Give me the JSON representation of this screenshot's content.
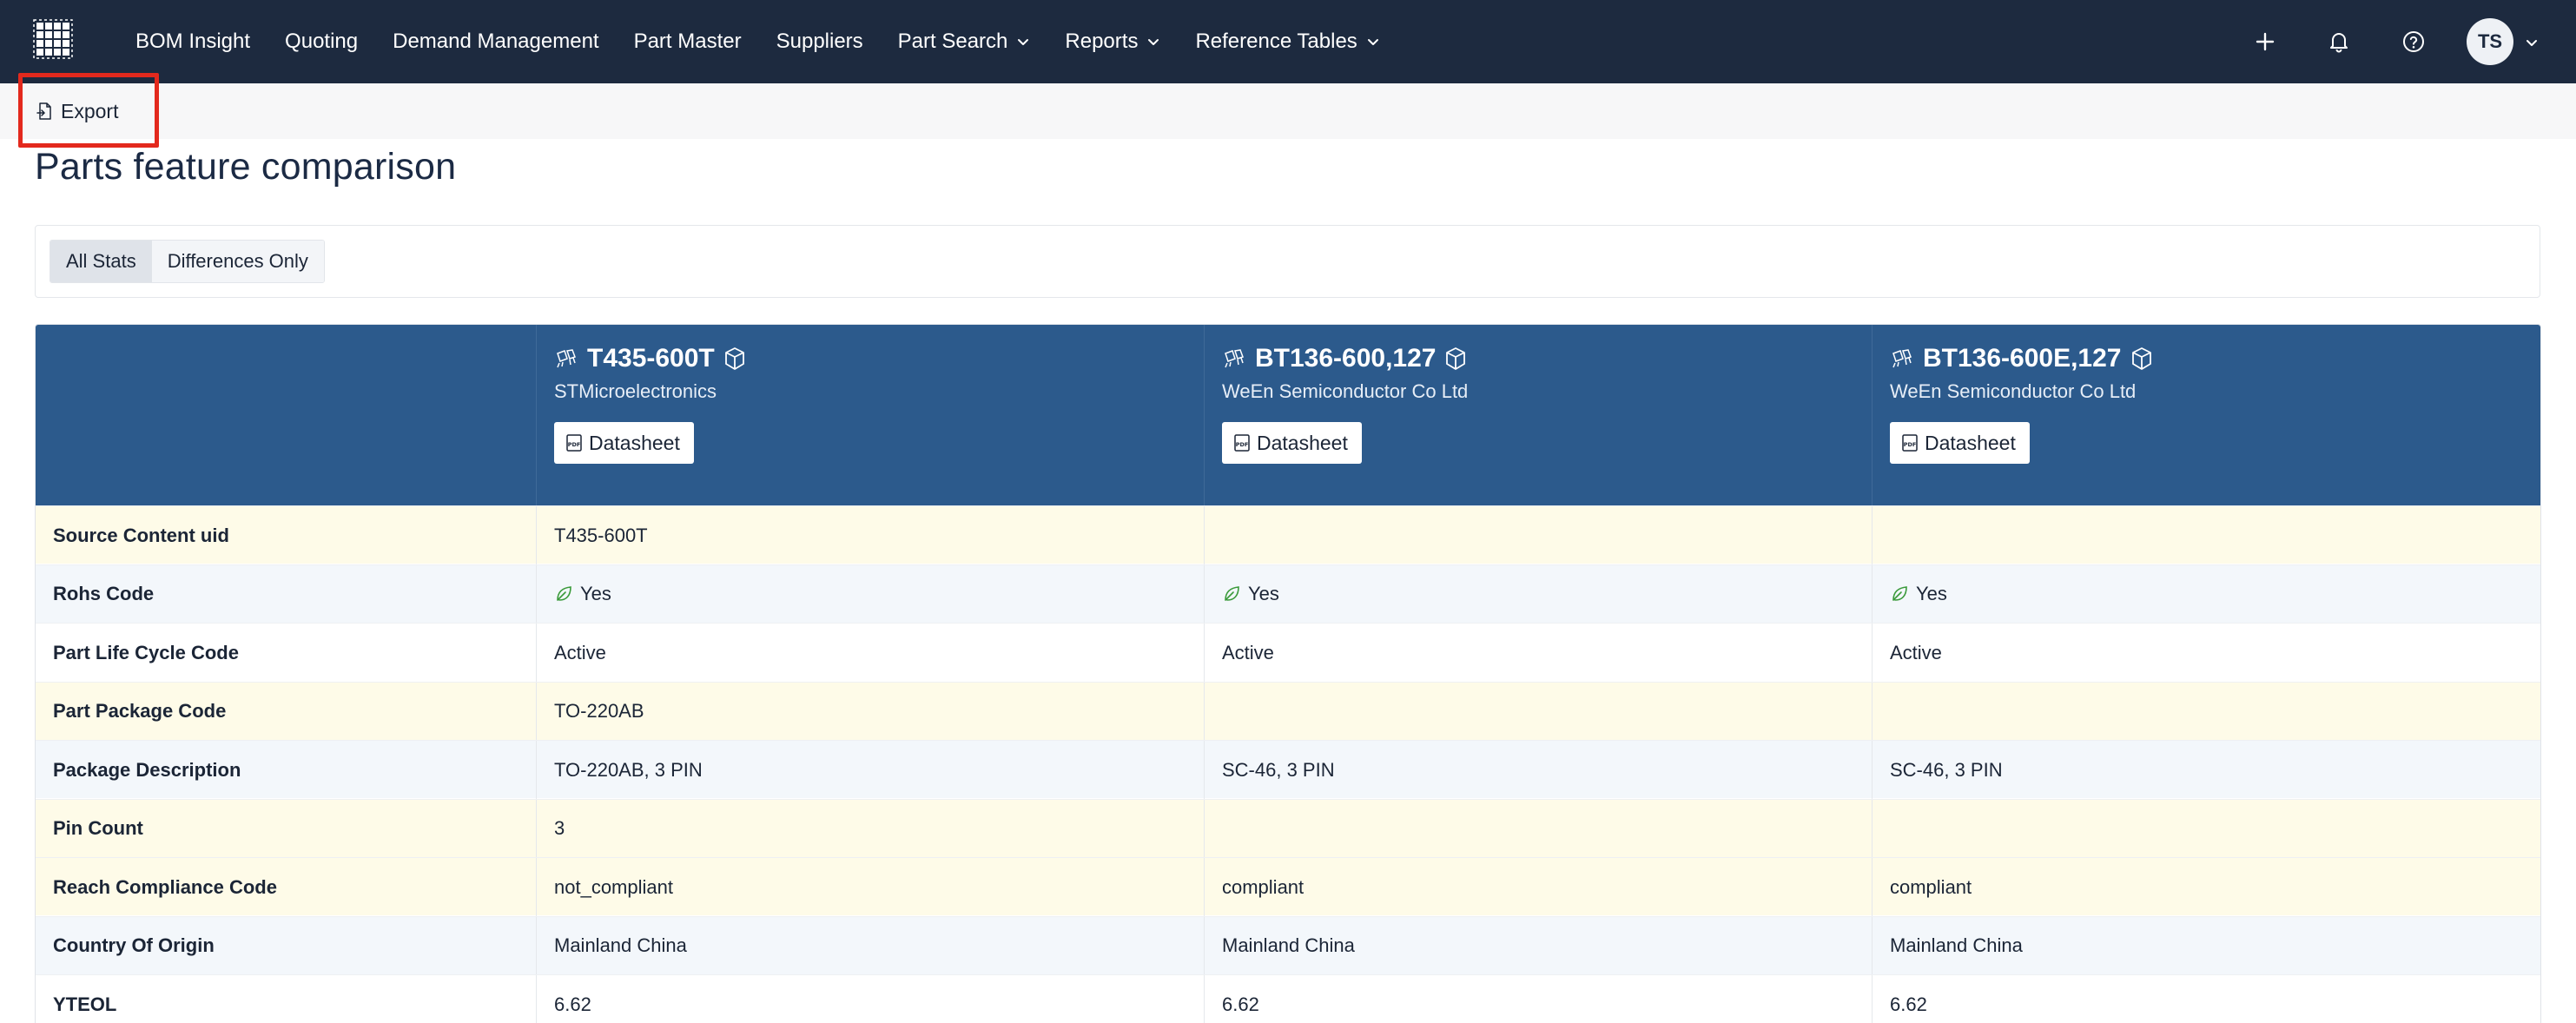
{
  "nav": {
    "items": [
      {
        "label": "BOM Insight",
        "dropdown": false
      },
      {
        "label": "Quoting",
        "dropdown": false
      },
      {
        "label": "Demand Management",
        "dropdown": false
      },
      {
        "label": "Part Master",
        "dropdown": false
      },
      {
        "label": "Suppliers",
        "dropdown": false
      },
      {
        "label": "Part Search",
        "dropdown": true
      },
      {
        "label": "Reports",
        "dropdown": true
      },
      {
        "label": "Reference Tables",
        "dropdown": true
      }
    ],
    "avatar_initials": "TS"
  },
  "toolbar": {
    "export_label": "Export"
  },
  "page_title": "Parts feature comparison",
  "filter": {
    "all_label": "All Stats",
    "diff_label": "Differences Only",
    "selected": "All Stats"
  },
  "parts": [
    {
      "name": "T435-600T",
      "manufacturer": "STMicroelectronics",
      "datasheet_label": "Datasheet"
    },
    {
      "name": "BT136-600,127",
      "manufacturer": "WeEn Semiconductor Co Ltd",
      "datasheet_label": "Datasheet"
    },
    {
      "name": "BT136-600E,127",
      "manufacturer": "WeEn Semiconductor Co Ltd",
      "datasheet_label": "Datasheet"
    }
  ],
  "rows": [
    {
      "label": "Source Content uid",
      "values": [
        "T435-600T",
        "",
        ""
      ]
    },
    {
      "label": "Rohs Code",
      "values": [
        "Yes",
        "Yes",
        "Yes"
      ]
    },
    {
      "label": "Part Life Cycle Code",
      "values": [
        "Active",
        "Active",
        "Active"
      ]
    },
    {
      "label": "Part Package Code",
      "values": [
        "TO-220AB",
        "",
        ""
      ]
    },
    {
      "label": "Package Description",
      "values": [
        "TO-220AB, 3 PIN",
        "SC-46, 3 PIN",
        "SC-46, 3 PIN"
      ]
    },
    {
      "label": "Pin Count",
      "values": [
        "3",
        "",
        ""
      ]
    },
    {
      "label": "Reach Compliance Code",
      "values": [
        "not_compliant",
        "compliant",
        "compliant"
      ]
    },
    {
      "label": "Country Of Origin",
      "values": [
        "Mainland China",
        "Mainland China",
        "Mainland China"
      ]
    },
    {
      "label": "YTEOL",
      "values": [
        "6.62",
        "6.62",
        "6.62"
      ]
    }
  ],
  "colors": {
    "nav_bg": "#1d2a3f",
    "table_header_bg": "#2c5a8c",
    "highlight": "#e3291d",
    "rohs_leaf": "#3a9a3a"
  }
}
